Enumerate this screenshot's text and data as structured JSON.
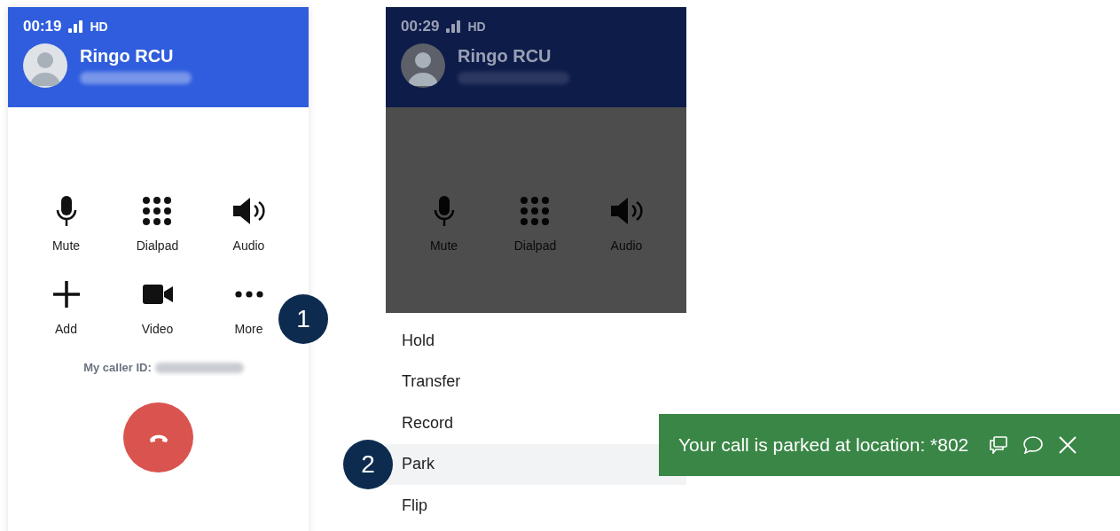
{
  "calls": [
    {
      "time": "00:19",
      "quality": "HD",
      "name": "Ringo RCU",
      "dimmed": false,
      "controls": [
        {
          "kind": "mute",
          "label": "Mute"
        },
        {
          "kind": "dialpad",
          "label": "Dialpad"
        },
        {
          "kind": "audio",
          "label": "Audio"
        },
        {
          "kind": "add",
          "label": "Add"
        },
        {
          "kind": "video",
          "label": "Video"
        },
        {
          "kind": "more",
          "label": "More"
        }
      ],
      "caller_id_label": "My caller ID:"
    },
    {
      "time": "00:29",
      "quality": "HD",
      "name": "Ringo RCU",
      "dimmed": true,
      "controls": [
        {
          "kind": "mute",
          "label": "Mute"
        },
        {
          "kind": "dialpad",
          "label": "Dialpad"
        },
        {
          "kind": "audio",
          "label": "Audio"
        }
      ]
    }
  ],
  "step_markers": [
    "1",
    "2"
  ],
  "menu": {
    "items": [
      {
        "label": "Hold",
        "selected": false
      },
      {
        "label": "Transfer",
        "selected": false
      },
      {
        "label": "Record",
        "selected": false
      },
      {
        "label": "Park",
        "selected": true
      },
      {
        "label": "Flip",
        "selected": false
      }
    ]
  },
  "toast": {
    "message": "Your call is parked at location: *802"
  }
}
